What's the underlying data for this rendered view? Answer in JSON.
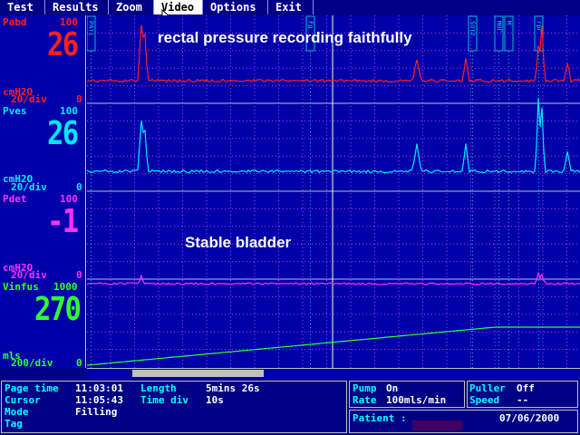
{
  "menu": [
    "Test",
    "Results",
    "Zoom",
    "Video",
    "Options",
    "Exit"
  ],
  "active_menu": "Video",
  "channels": [
    {
      "name": "Pabd",
      "max": "100",
      "value": "26",
      "unit": "cmH2O",
      "scale": "20/div",
      "min": "0",
      "color": "#ff2020"
    },
    {
      "name": "Pves",
      "max": "100",
      "value": "26",
      "unit": "cmH2O",
      "scale": "20/div",
      "min": "0",
      "color": "#00e8ff"
    },
    {
      "name": "Pdet",
      "max": "100",
      "value": "-1",
      "unit": "cmH2O",
      "scale": "20/div",
      "min": "0",
      "color": "#ff30ff"
    },
    {
      "name": "Vinfus",
      "max": "1000",
      "value": "270",
      "unit": "mls",
      "scale": "200/div",
      "min": "0",
      "color": "#30ff30"
    }
  ],
  "annotations": {
    "top": "rectal pressure recording faithfully",
    "middle": "Stable bladder"
  },
  "event_markers": [
    "PАті",
    "Fд",
    "Sптл",
    "МОГ",
    "М",
    "грг"
  ],
  "info": {
    "page_time_label": "Page time",
    "page_time": "11:03:01",
    "length_label": "Length",
    "length": "5mins 26s",
    "cursor_label": "Cursor",
    "cursor": "11:05:43",
    "time_div_label": "Time div",
    "time_div": "10s",
    "mode_label": "Mode",
    "mode": "Filling",
    "tag_label": "Tag",
    "pump_label": "Pump",
    "pump": "On",
    "rate_label": "Rate",
    "rate": "100mls/min",
    "puller_label": "Puller",
    "puller": "Off",
    "speed_label": "Speed",
    "speed": "--",
    "patient_label": "Patient :",
    "date": "07/06/2000"
  }
}
